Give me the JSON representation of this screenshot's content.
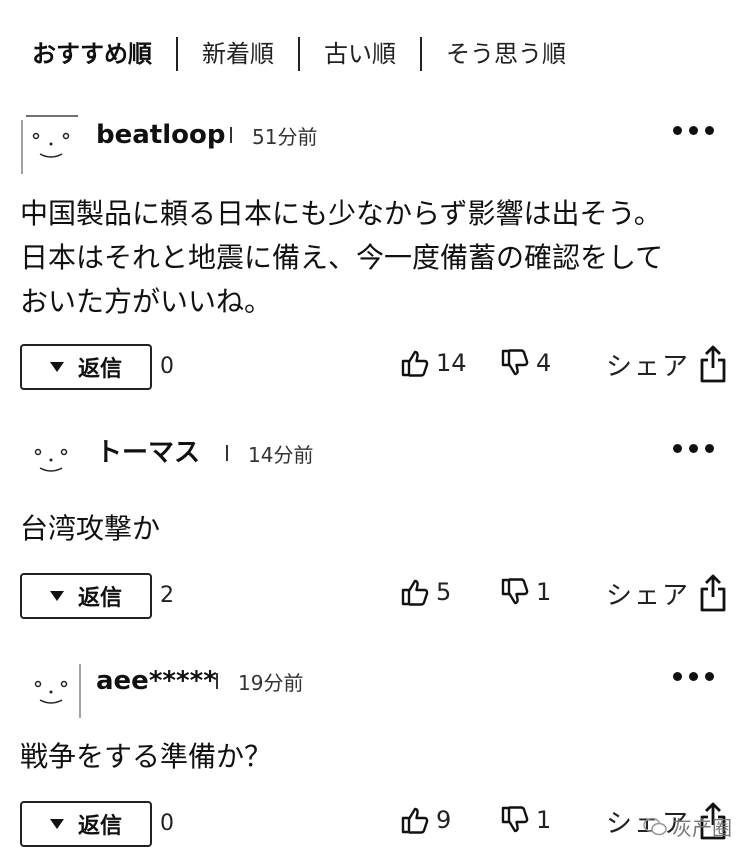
{
  "sort_tabs": [
    {
      "label": "おすすめ順",
      "active": true
    },
    {
      "label": "新着順",
      "active": false
    },
    {
      "label": "古い順",
      "active": false
    },
    {
      "label": "そう思う順",
      "active": false
    }
  ],
  "comments": [
    {
      "user": "beatloop",
      "time": "51分前",
      "text": "中国製品に頼る日本にも少なからず影響は出そう。\n日本はそれと地震に備え、今一度備蓄の確認をして\nおいた方がいいね。",
      "reply_label": "返信",
      "reply_count": "0",
      "likes": "14",
      "dislikes": "4",
      "share_label": "シェア"
    },
    {
      "user": "トーマス",
      "time": "14分前",
      "text": "台湾攻撃か",
      "reply_label": "返信",
      "reply_count": "2",
      "likes": "5",
      "dislikes": "1",
      "share_label": "シェア"
    },
    {
      "user": "aee*****",
      "time": "19分前",
      "text": "戦争をする準備か？",
      "reply_label": "返信",
      "reply_count": "0",
      "likes": "9",
      "dislikes": "1",
      "share_label": "シェア"
    }
  ],
  "icons": {
    "avatar": "face-avatar-icon",
    "more": "more-dots-icon",
    "reply": "triangle-down-icon",
    "like": "thumbs-up-icon",
    "dislike": "thumbs-down-icon",
    "share": "share-icon"
  },
  "watermark": "灰产圈"
}
